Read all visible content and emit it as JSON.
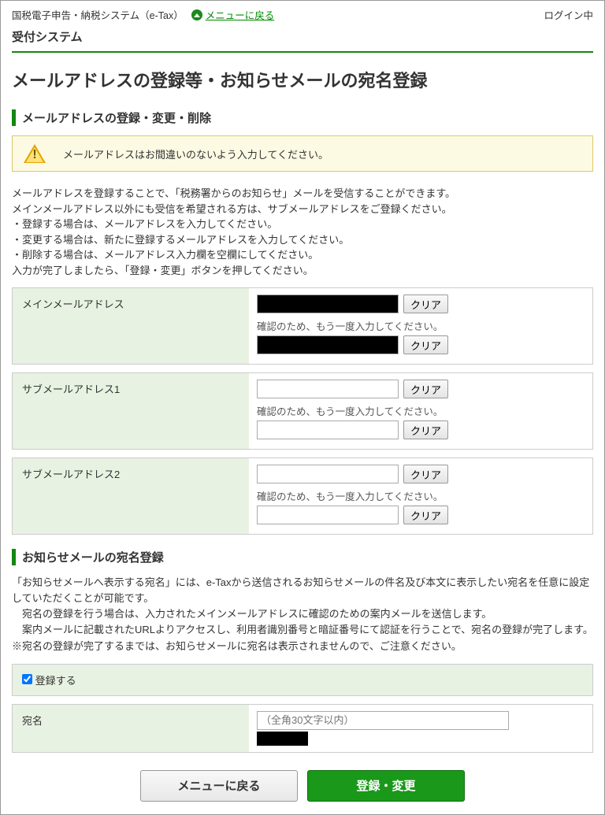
{
  "header": {
    "system_name": "国税電子申告・納税システム（e-Tax）",
    "back_link": "メニューに戻る",
    "login_status": "ログイン中",
    "subsystem": "受付システム"
  },
  "page_title": "メールアドレスの登録等・お知らせメールの宛名登録",
  "section1": {
    "heading": "メールアドレスの登録・変更・削除",
    "warning": "メールアドレスはお間違いのないよう入力してください。",
    "desc_line1": "メールアドレスを登録することで、「税務署からのお知らせ」メールを受信することができます。",
    "desc_line2": "メインメールアドレス以外にも受信を希望される方は、サブメールアドレスをご登録ください。",
    "desc_line3": "・登録する場合は、メールアドレスを入力してください。",
    "desc_line4": "・変更する場合は、新たに登録するメールアドレスを入力してください。",
    "desc_line5": "・削除する場合は、メールアドレス入力欄を空欄にしてください。",
    "desc_line6": "入力が完了しましたら、「登録・変更」ボタンを押してください。",
    "confirm_hint": "確認のため、もう一度入力してください。",
    "clear_label": "クリア",
    "fields": [
      {
        "label": "メインメールアドレス",
        "has_value": true
      },
      {
        "label": "サブメールアドレス1",
        "has_value": false
      },
      {
        "label": "サブメールアドレス2",
        "has_value": false
      }
    ]
  },
  "section2": {
    "heading": "お知らせメールの宛名登録",
    "p_line1": "「お知らせメールへ表示する宛名」には、e-Taxから送信されるお知らせメールの件名及び本文に表示したい宛名を任意に設定していただくことが可能です。",
    "p_line2": "宛名の登録を行う場合は、入力されたメインメールアドレスに確認のための案内メールを送信します。",
    "p_line3": "案内メールに記載されたURLよりアクセスし、利用者識別番号と暗証番号にて認証を行うことで、宛名の登録が完了します。",
    "p_line4": "※宛名の登録が完了するまでは、お知らせメールに宛名は表示されませんので、ご注意ください。",
    "register_checkbox": "登録する",
    "name_label": "宛名",
    "name_placeholder": "（全角30文字以内）"
  },
  "buttons": {
    "back": "メニューに戻る",
    "submit": "登録・変更"
  }
}
